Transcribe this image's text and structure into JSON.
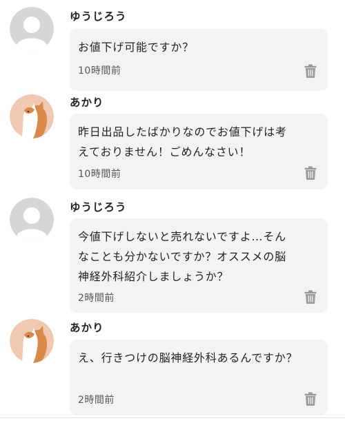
{
  "comments": [
    {
      "user": "ゆうじろう",
      "avatar": "default-user-avatar",
      "text": "お値下げ可能ですか？",
      "time": "10時間前"
    },
    {
      "user": "あかり",
      "avatar": "cat-avatar",
      "text": "昨日出品したばかりなのでお値下げは考\nえておりません！ごめんなさい！",
      "time": "10時間前"
    },
    {
      "user": "ゆうじろう",
      "avatar": "default-user-avatar",
      "text": "今値下げしないと売れないですよ…そん\nなことも分かないですか？オススメの脳\n神経外科紹介しましょうか？",
      "time": "2時間前"
    },
    {
      "user": "あかり",
      "avatar": "cat-avatar",
      "text": "え、行きつけの脳神経外科あるんですか？",
      "time": "2時間前"
    }
  ],
  "icons": {
    "delete": "trash-icon"
  },
  "colors": {
    "bubble": "#f3f3f3",
    "default_avatar_bg": "#d6d6d6",
    "cat_avatar_bg": "#f0c9b2",
    "cat_fur": "#d98a4a"
  }
}
